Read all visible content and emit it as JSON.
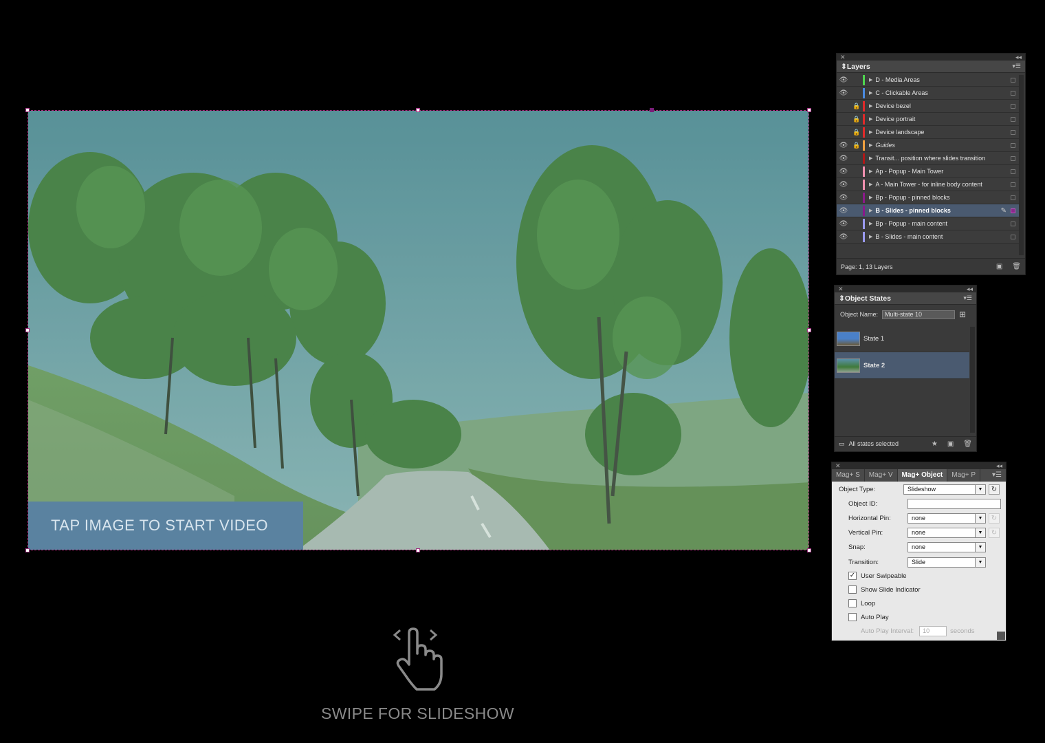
{
  "slideshow": {
    "tap_label": "TAP IMAGE TO START VIDEO",
    "swipe_label": "SWIPE FOR SLIDESHOW"
  },
  "layers_panel": {
    "title": "Layers",
    "footer": "Page: 1, 13 Layers",
    "rows": [
      {
        "name": "D - Media Areas",
        "eye": true,
        "lock": false,
        "color": "#4fd44f",
        "italic": false,
        "selected": false
      },
      {
        "name": "C - Clickable Areas",
        "eye": true,
        "lock": false,
        "color": "#4a8ae0",
        "italic": false,
        "selected": false
      },
      {
        "name": "Device bezel",
        "eye": false,
        "lock": true,
        "color": "#e02a2a",
        "italic": false,
        "selected": false
      },
      {
        "name": "Device portrait",
        "eye": false,
        "lock": true,
        "color": "#e02a2a",
        "italic": false,
        "selected": false
      },
      {
        "name": "Device landscape",
        "eye": false,
        "lock": true,
        "color": "#e02a2a",
        "italic": false,
        "selected": false
      },
      {
        "name": "Guides",
        "eye": true,
        "lock": true,
        "color": "#f0a040",
        "italic": true,
        "selected": false
      },
      {
        "name": "Transit... position where slides transition",
        "eye": true,
        "lock": false,
        "color": "#b01818",
        "italic": false,
        "selected": false
      },
      {
        "name": "Ap - Popup - Main Tower",
        "eye": true,
        "lock": false,
        "color": "#f090b0",
        "italic": false,
        "selected": false
      },
      {
        "name": "A - Main Tower - for inline body content",
        "eye": true,
        "lock": false,
        "color": "#f090b0",
        "italic": false,
        "selected": false
      },
      {
        "name": "Bp - Popup - pinned blocks",
        "eye": true,
        "lock": false,
        "color": "#8a1a8a",
        "italic": false,
        "selected": false
      },
      {
        "name": "B - Slides - pinned blocks",
        "eye": true,
        "lock": false,
        "color": "#8a1a8a",
        "italic": false,
        "selected": true
      },
      {
        "name": "Bp - Popup - main content",
        "eye": true,
        "lock": false,
        "color": "#9a9af0",
        "italic": false,
        "selected": false
      },
      {
        "name": "B - Slides - main content",
        "eye": true,
        "lock": false,
        "color": "#9a9af0",
        "italic": false,
        "selected": false
      }
    ]
  },
  "states_panel": {
    "title": "Object States",
    "object_name_label": "Object Name:",
    "object_name_value": "Multi-state 10",
    "states": [
      {
        "name": "State 1",
        "selected": false
      },
      {
        "name": "State 2",
        "selected": true
      }
    ],
    "footer": "All states selected"
  },
  "magplus_panel": {
    "tabs": [
      "Mag+ S",
      "Mag+ V",
      "Mag+ Object",
      "Mag+ P"
    ],
    "object_type_label": "Object Type:",
    "object_type_value": "Slideshow",
    "object_id_label": "Object ID:",
    "object_id_value": "",
    "hpin_label": "Horizontal Pin:",
    "hpin_value": "none",
    "vpin_label": "Vertical Pin:",
    "vpin_value": "none",
    "snap_label": "Snap:",
    "snap_value": "none",
    "transition_label": "Transition:",
    "transition_value": "Slide",
    "user_swipeable_label": "User Swipeable",
    "user_swipeable": true,
    "show_slide_indicator_label": "Show Slide Indicator",
    "show_slide_indicator": false,
    "loop_label": "Loop",
    "loop": false,
    "auto_play_label": "Auto Play",
    "auto_play": false,
    "auto_play_interval_label": "Auto Play Interval:",
    "auto_play_interval_value": "10",
    "auto_play_interval_unit": "seconds"
  }
}
